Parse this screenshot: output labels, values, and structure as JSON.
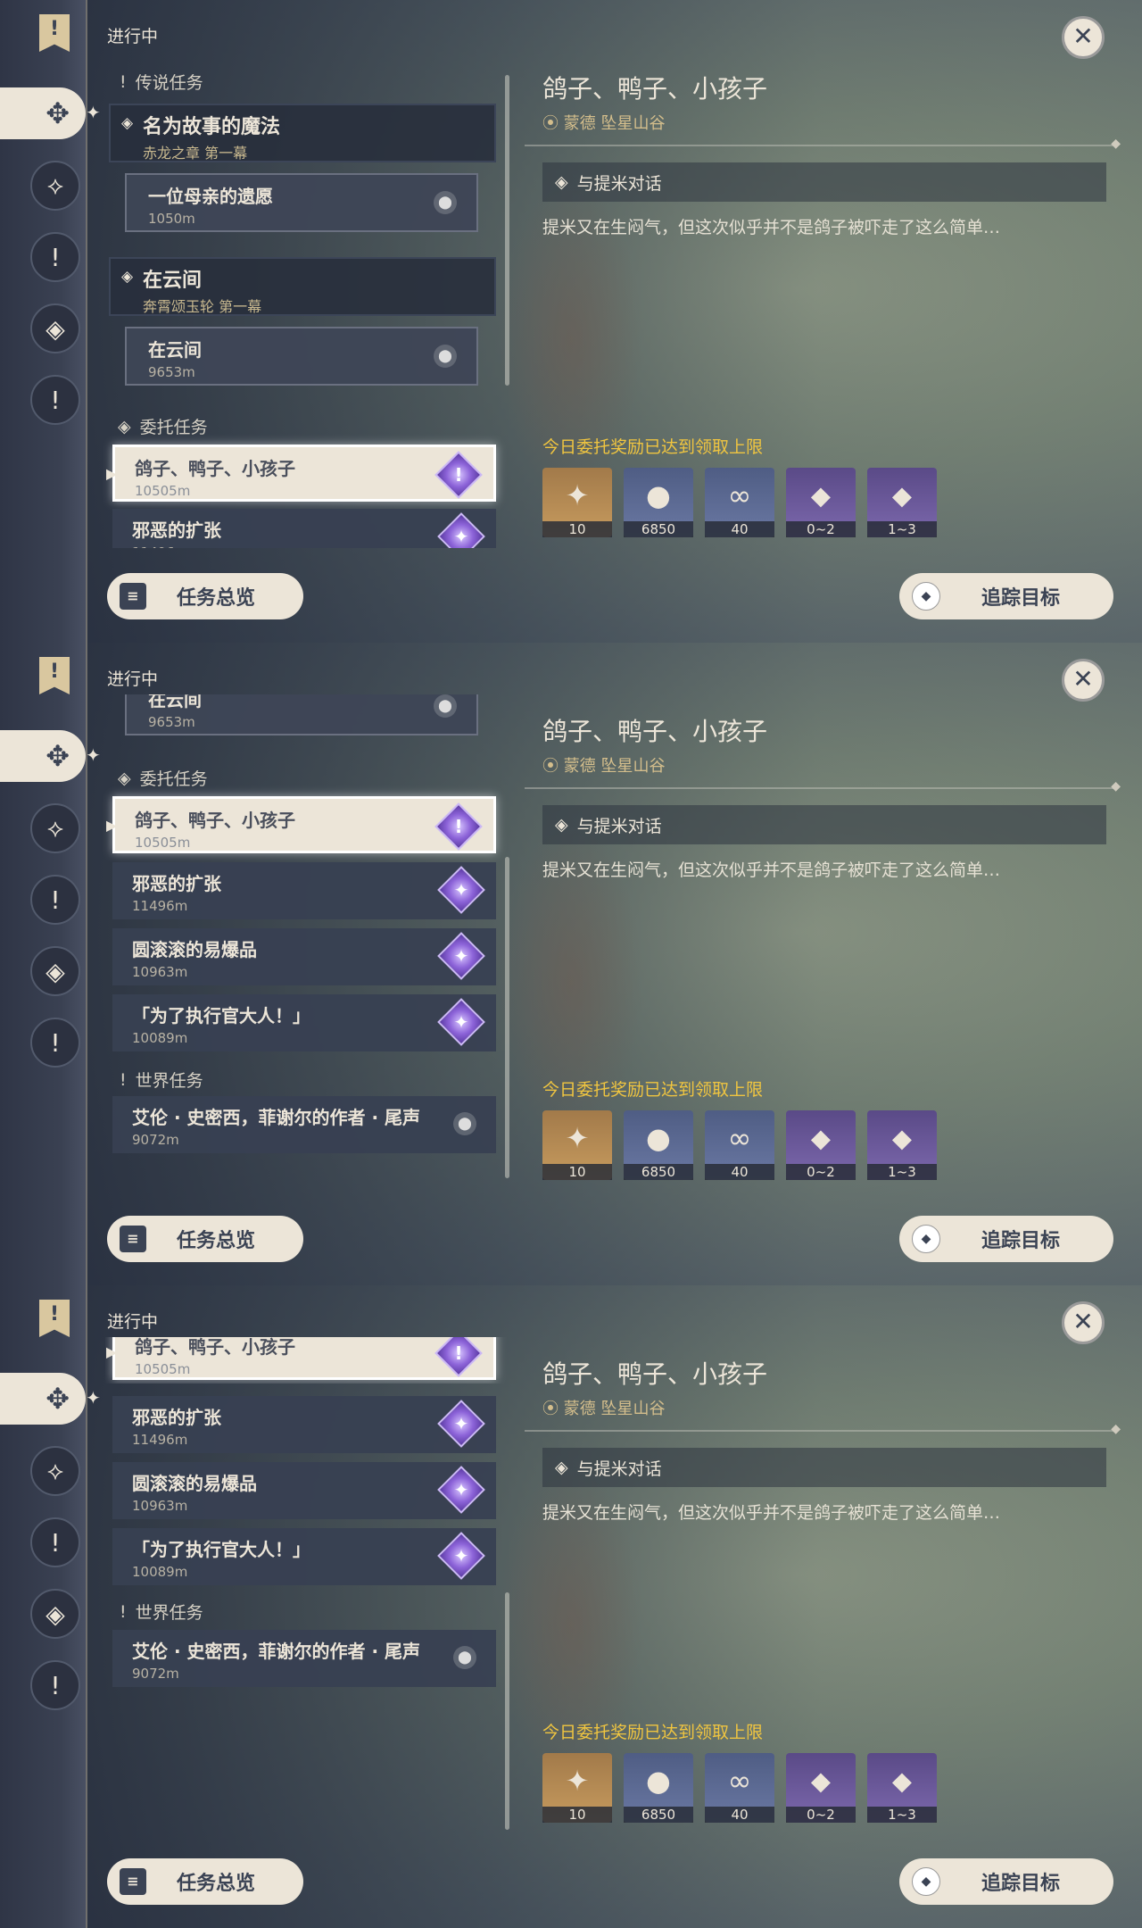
{
  "rail": {
    "bookmark_glyph": "!",
    "icons": [
      "archon-quest-icon",
      "story-quest-icon",
      "world-quest-icon",
      "commission-icon",
      "event-quest-icon"
    ]
  },
  "list": {
    "status": "进行中",
    "legend_header": "传说任务",
    "main_quests": [
      {
        "title": "名为故事的魔法",
        "subtitle": "赤龙之章 第一幕",
        "sub_title": "一位母亲的遗愿",
        "sub_distance": "1050m"
      },
      {
        "title": "在云间",
        "subtitle": "奔霄颂玉轮 第一幕",
        "sub_title": "在云间",
        "sub_distance": "9653m"
      }
    ],
    "commission_header": "委托任务",
    "commissions": [
      {
        "title": "鸽子、鸭子、小孩子",
        "distance": "10505m"
      },
      {
        "title": "邪恶的扩张",
        "distance": "11496m"
      },
      {
        "title": "圆滚滚的易爆品",
        "distance": "10963m"
      },
      {
        "title": "「为了执行官大人！」",
        "distance": "10089m"
      }
    ],
    "world_header": "世界任务",
    "world_quest": {
      "title": "艾伦 · 史密西，菲谢尔的作者 · 尾声",
      "distance": "9072m"
    },
    "overview_label": "任务总览"
  },
  "detail": {
    "title": "鸽子、鸭子、小孩子",
    "location": "蒙德 坠星山谷",
    "objective": "与提米对话",
    "description": "提米又在生闷气，但这次似乎并不是鸽子被吓走了这么简单…",
    "limit_notice": "今日委托奖励已达到领取上限",
    "rewards": [
      {
        "icon": "adventure-exp-icon",
        "count": "10",
        "style": "gold"
      },
      {
        "icon": "mora-icon",
        "count": "6850",
        "style": "blue"
      },
      {
        "icon": "friendship-exp-icon",
        "count": "40",
        "style": "blue"
      },
      {
        "icon": "crystal-chunk-icon",
        "count": "0~2",
        "style": "purp"
      },
      {
        "icon": "crystal-cluster-icon",
        "count": "1~3",
        "style": "purp"
      }
    ],
    "track_label": "追踪目标"
  }
}
